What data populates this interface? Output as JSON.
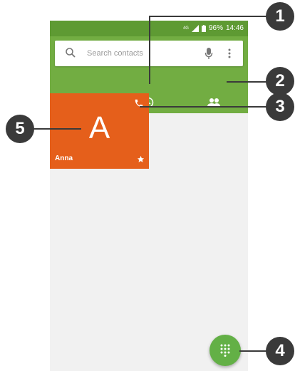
{
  "status_bar": {
    "network": "4G",
    "battery": "96%",
    "time": "14:46"
  },
  "search": {
    "placeholder": "Search contacts"
  },
  "tabs": [
    {
      "icon": "star-icon",
      "selected": true
    },
    {
      "icon": "clock-icon",
      "selected": false
    },
    {
      "icon": "people-icon",
      "selected": false
    }
  ],
  "contacts": [
    {
      "initial": "A",
      "name": "Anna",
      "favorite": true
    }
  ],
  "callouts": [
    "1",
    "2",
    "3",
    "4",
    "5"
  ],
  "colors": {
    "status_bar": "#5e9a33",
    "header": "#72ad42",
    "contact_tile": "#e55f1b",
    "fab": "#63b046",
    "callout": "#3a3a3a"
  }
}
